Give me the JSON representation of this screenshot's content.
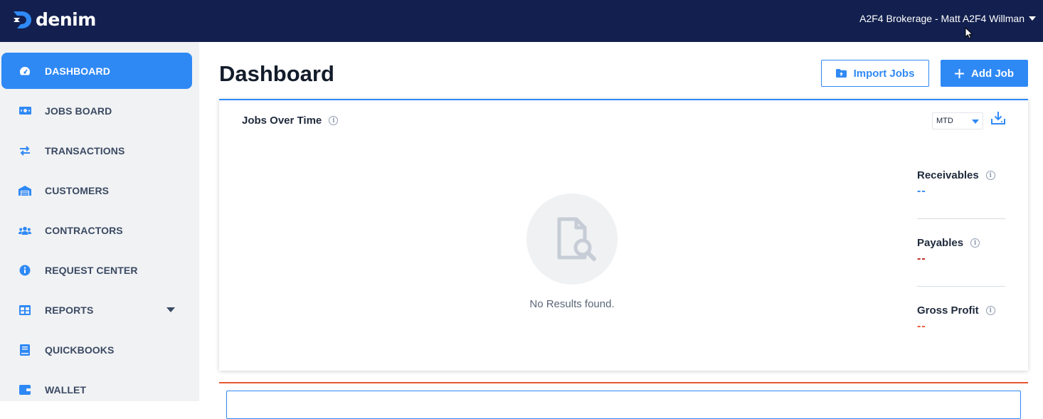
{
  "header": {
    "logo_text": "denim",
    "account_label": "A2F4 Brokerage - Matt A2F4 Willman"
  },
  "sidebar": {
    "items": [
      {
        "label": "DASHBOARD",
        "icon": "gauge-icon",
        "active": true
      },
      {
        "label": "JOBS BOARD",
        "icon": "money-bill-icon"
      },
      {
        "label": "TRANSACTIONS",
        "icon": "exchange-arrows-icon"
      },
      {
        "label": "CUSTOMERS",
        "icon": "warehouse-icon"
      },
      {
        "label": "CONTRACTORS",
        "icon": "users-icon"
      },
      {
        "label": "REQUEST CENTER",
        "icon": "info-circle-icon"
      },
      {
        "label": "REPORTS",
        "icon": "table-icon",
        "has_dropdown": true
      },
      {
        "label": "QUICKBOOKS",
        "icon": "book-icon"
      },
      {
        "label": "WALLET",
        "icon": "wallet-icon"
      }
    ]
  },
  "main": {
    "title": "Dashboard",
    "import_button": "Import Jobs",
    "add_button": "Add Job",
    "chart_card": {
      "title": "Jobs Over Time",
      "period": "MTD",
      "empty_message": "No Results found."
    },
    "metrics": [
      {
        "label": "Receivables",
        "value": "--",
        "color": "#2f89f5"
      },
      {
        "label": "Payables",
        "value": "--",
        "color": "#c0251f"
      },
      {
        "label": "Gross Profit",
        "value": "--",
        "color": "#e8552f"
      }
    ]
  },
  "colors": {
    "topbar": "#13204f",
    "accent": "#2f89f5",
    "sidebar_bg": "#f1f2f4"
  }
}
